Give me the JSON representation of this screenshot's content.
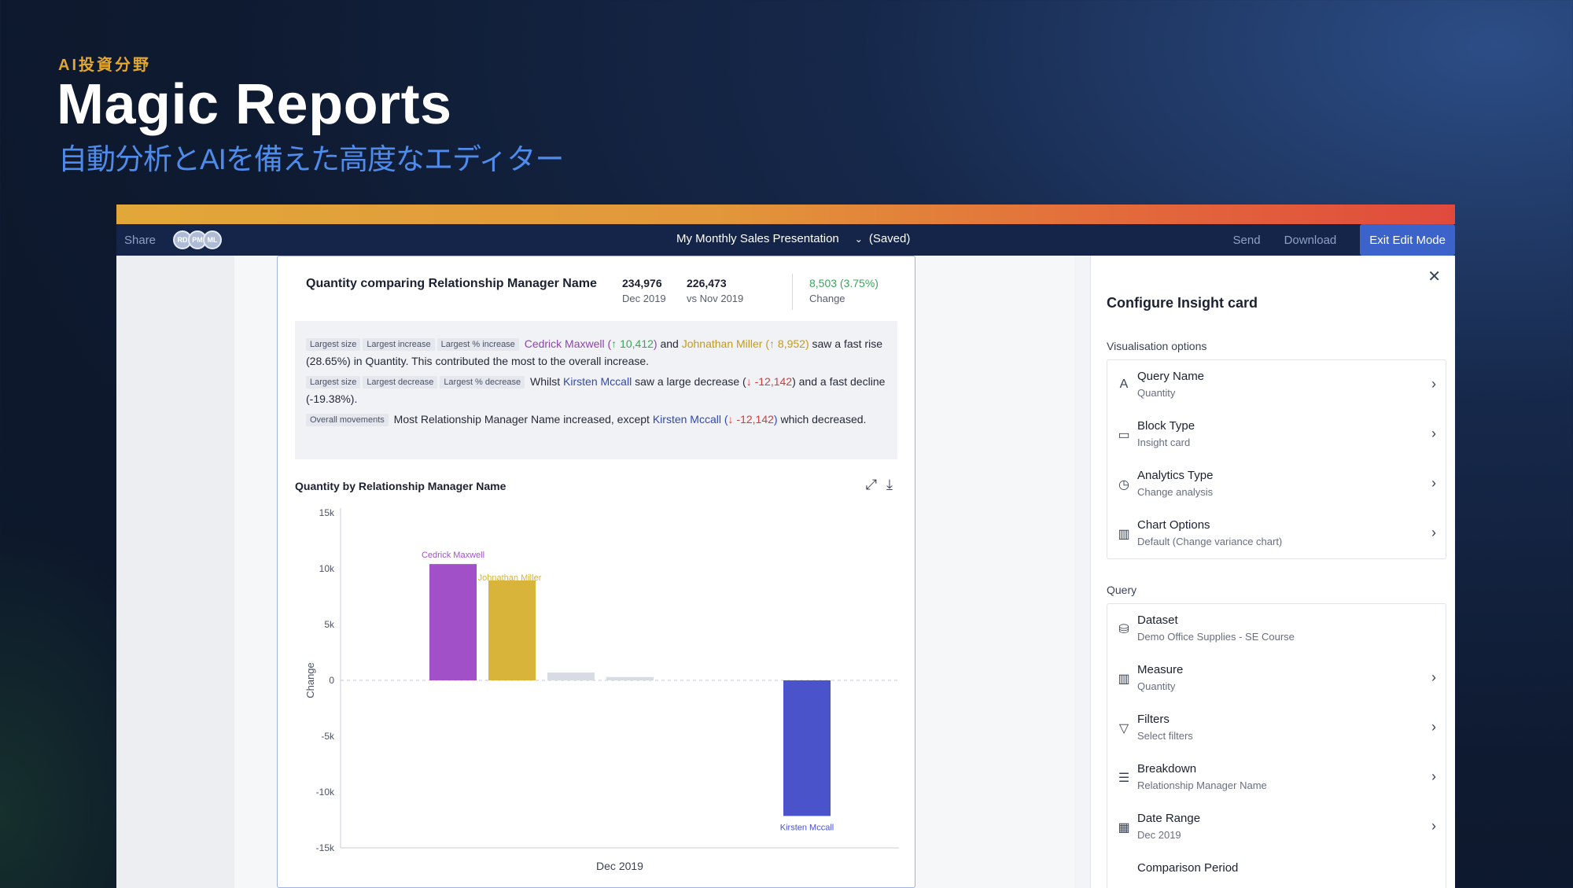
{
  "slide": {
    "eyebrow": "AI投資分野",
    "headline": "Magic Reports",
    "subhead": "自動分析とAIを備えた高度なエディター"
  },
  "colors": {
    "accent_bar": [
      "#e2a739",
      "#e04a3d"
    ],
    "topbar": "#142549",
    "primary_button": "#3c63c9"
  },
  "topbar": {
    "share_label": "Share",
    "avatars": [
      "RD",
      "PM",
      "ML"
    ],
    "document_title": "My Monthly Sales Presentation",
    "status": "(Saved)",
    "send_label": "Send",
    "download_label": "Download",
    "exit_label": "Exit Edit Mode"
  },
  "card": {
    "title": "Quantity comparing Relationship Manager Name",
    "stats": [
      {
        "value": "234,976",
        "label": "Dec 2019"
      },
      {
        "value": "226,473",
        "label": "vs Nov 2019"
      },
      {
        "value": "8,503 (3.75%)",
        "label": "Change"
      }
    ],
    "insights": {
      "p1": {
        "tags": [
          "Largest size",
          "Largest increase",
          "Largest % increase"
        ],
        "name1": "Cedrick Maxwell",
        "val1": "↑ 10,412",
        "and": " and ",
        "name2": "Johnathan Miller",
        "val2": "↑ 8,952",
        "tail": " saw a fast rise (28.65%) in Quantity. This contributed the most to the overall increase."
      },
      "p2": {
        "tags": [
          "Largest size",
          "Largest decrease",
          "Largest % decrease"
        ],
        "pre": "Whilst ",
        "name": "Kirsten Mccall",
        "mid": " saw a large decrease (",
        "val": "↓ -12,142",
        "tail": ") and a fast decline (-19.38%)."
      },
      "p3": {
        "tag": "Overall movements",
        "pre": " Most Relationship Manager Name increased, except ",
        "name": "Kirsten Mccall",
        "val": "↓ -12,142",
        "tail": " which decreased."
      }
    },
    "chart_title": "Quantity by Relationship Manager Name"
  },
  "chart_data": {
    "type": "bar",
    "title": "Quantity by Relationship Manager Name",
    "xlabel": "Dec 2019",
    "ylabel": "Change",
    "ylim": [
      -15000,
      15000
    ],
    "ticks": [
      "15k",
      "10k",
      "5k",
      "0",
      "-5k",
      "-10k",
      "-15k"
    ],
    "tick_values": [
      15000,
      10000,
      5000,
      0,
      -5000,
      -10000,
      -15000
    ],
    "categories": [
      "Cedrick Maxwell",
      "Johnathan Miller",
      "",
      "",
      "",
      "",
      "Kirsten Mccall"
    ],
    "values": [
      10412,
      8952,
      700,
      300,
      0,
      0,
      -12142
    ],
    "bar_colors": [
      "#a150c8",
      "#d9b43a",
      "#d7dbe3",
      "#d7dbe3",
      "#d7dbe3",
      "#d7dbe3",
      "#4a53c9"
    ],
    "labels_above": [
      "Cedrick Maxwell",
      "Johnathan Miller",
      "",
      "",
      "",
      "",
      ""
    ],
    "labels_below": [
      "",
      "",
      "",
      "",
      "",
      "",
      "Kirsten Mccall"
    ],
    "grid": false
  },
  "panel": {
    "title": "Configure Insight card",
    "visualisation_label": "Visualisation options",
    "visualisation": [
      {
        "icon": "font-icon",
        "glyph": "A",
        "title": "Query Name",
        "sub": "Quantity"
      },
      {
        "icon": "card-icon",
        "glyph": "▭",
        "title": "Block Type",
        "sub": "Insight card"
      },
      {
        "icon": "clock-icon",
        "glyph": "◷",
        "title": "Analytics Type",
        "sub": "Change analysis"
      },
      {
        "icon": "bar-chart-icon",
        "glyph": "▥",
        "title": "Chart Options",
        "sub": "Default (Change variance chart)"
      }
    ],
    "query_label": "Query",
    "query": [
      {
        "icon": "database-icon",
        "glyph": "⛁",
        "title": "Dataset",
        "sub": "Demo Office Supplies - SE Course",
        "arrow": false
      },
      {
        "icon": "columns-icon",
        "glyph": "▥",
        "title": "Measure",
        "sub": "Quantity",
        "arrow": true
      },
      {
        "icon": "filter-icon",
        "glyph": "▽",
        "title": "Filters",
        "sub": "Select filters",
        "arrow": true
      },
      {
        "icon": "breakdown-icon",
        "glyph": "☰",
        "title": "Breakdown",
        "sub": "Relationship Manager Name",
        "arrow": true
      },
      {
        "icon": "calendar-icon",
        "glyph": "▦",
        "title": "Date Range",
        "sub": "Dec 2019",
        "arrow": true
      },
      {
        "icon": "compare-icon",
        "glyph": "",
        "title": "Comparison Period",
        "sub": "",
        "arrow": false
      }
    ]
  }
}
